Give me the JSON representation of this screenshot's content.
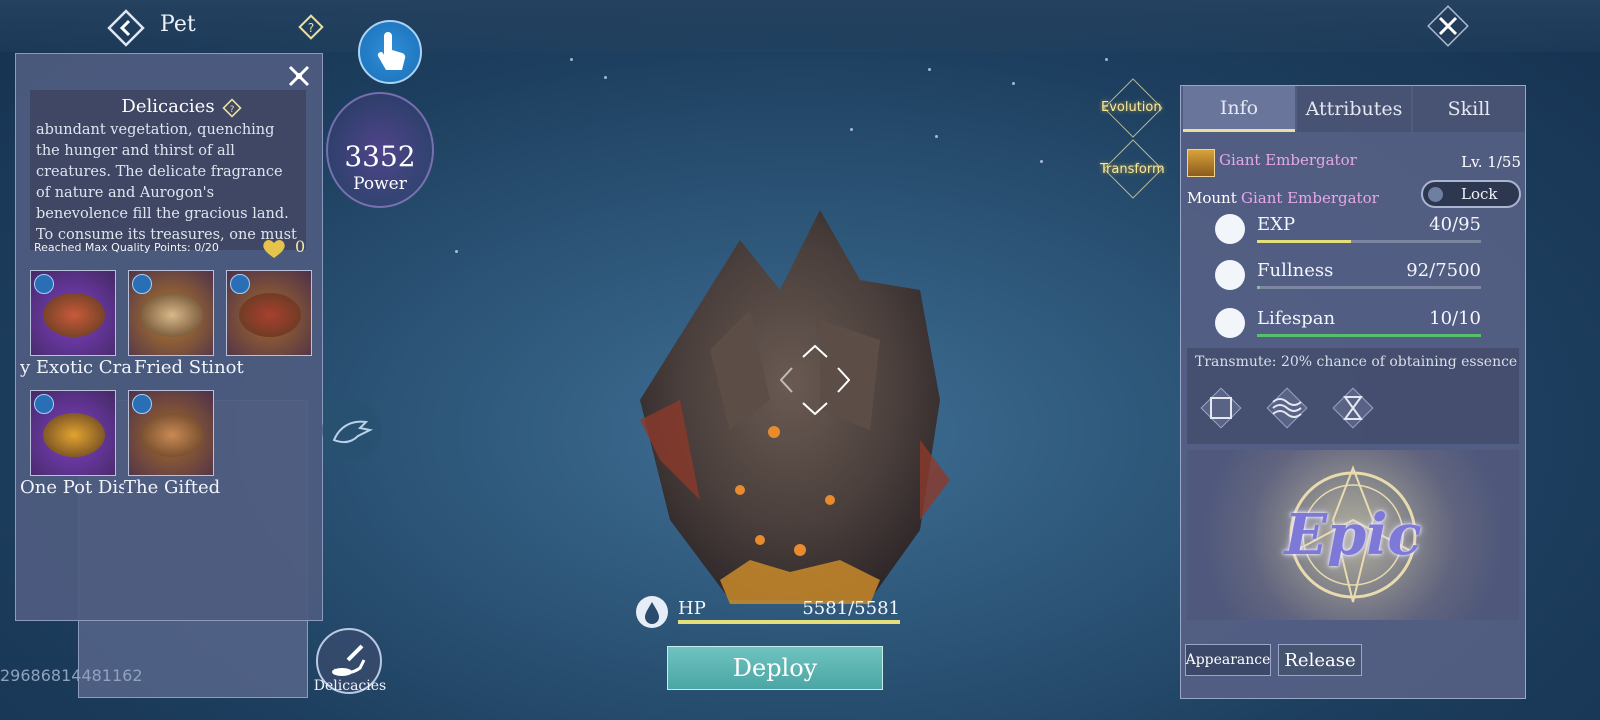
{
  "header": {
    "title": "Pet"
  },
  "delicacies_panel": {
    "title": "Delicacies",
    "description": "abundant vegetation, quenching the hunger and thirst of all creatures. The delicate fragrance of nature and Aurogon's benevolence fill the gracious land. To consume its treasures, one must be blessed. Eat",
    "quality_text": "Reached Max Quality Points: 0/20",
    "heart_count": "0",
    "items": [
      {
        "label": "y Exotic Cra",
        "dish_color": "#c85a3a",
        "bg": "#7c3fc4"
      },
      {
        "label": "Fried Stinot",
        "dish_color": "#d7b98a",
        "bg": "#b67a2a"
      },
      {
        "label": "",
        "dish_color": "#a8402f",
        "bg": "#a56a2b"
      },
      {
        "label": "One Pot Dis",
        "dish_color": "#e2a430",
        "bg": "#7c3fc4"
      },
      {
        "label": "The Gifted",
        "dish_color": "#c98a55",
        "bg": "#a56a2b"
      }
    ]
  },
  "account_id": "29686814481162",
  "power": {
    "value": "3352",
    "label": "Power"
  },
  "delicacies_button": {
    "label": "Delicacies"
  },
  "hp": {
    "label": "HP",
    "value": "5581/5581",
    "fraction": 1.0
  },
  "deploy_label": "Deploy",
  "side_actions": {
    "evolution": "Evolution",
    "transform": "Transform"
  },
  "info_panel": {
    "tabs": [
      "Info",
      "Attributes",
      "Skill"
    ],
    "active_tab": 0,
    "pet_name": "Giant Embergator",
    "level": "Lv. 1/55",
    "mount_label": "Mount",
    "mount_name": "Giant Embergator",
    "lock_label": "Lock",
    "stats": [
      {
        "name": "EXP",
        "value": "40/95",
        "fraction": 0.42,
        "color": "#e4df7a"
      },
      {
        "name": "Fullness",
        "value": "92/7500",
        "fraction": 0.012,
        "color": "#6fcf7f"
      },
      {
        "name": "Lifespan",
        "value": "10/10",
        "fraction": 1.0,
        "color": "#57c06a"
      }
    ],
    "transmute_text": "Transmute: 20% chance of obtaining essence",
    "rarity": "Epic",
    "appearance_label": "Appearance",
    "release_label": "Release"
  },
  "colors": {
    "accent_gold": "#e9dfa2",
    "name_pink": "#e6a8e6",
    "deploy_teal": "#5ab4b2"
  }
}
